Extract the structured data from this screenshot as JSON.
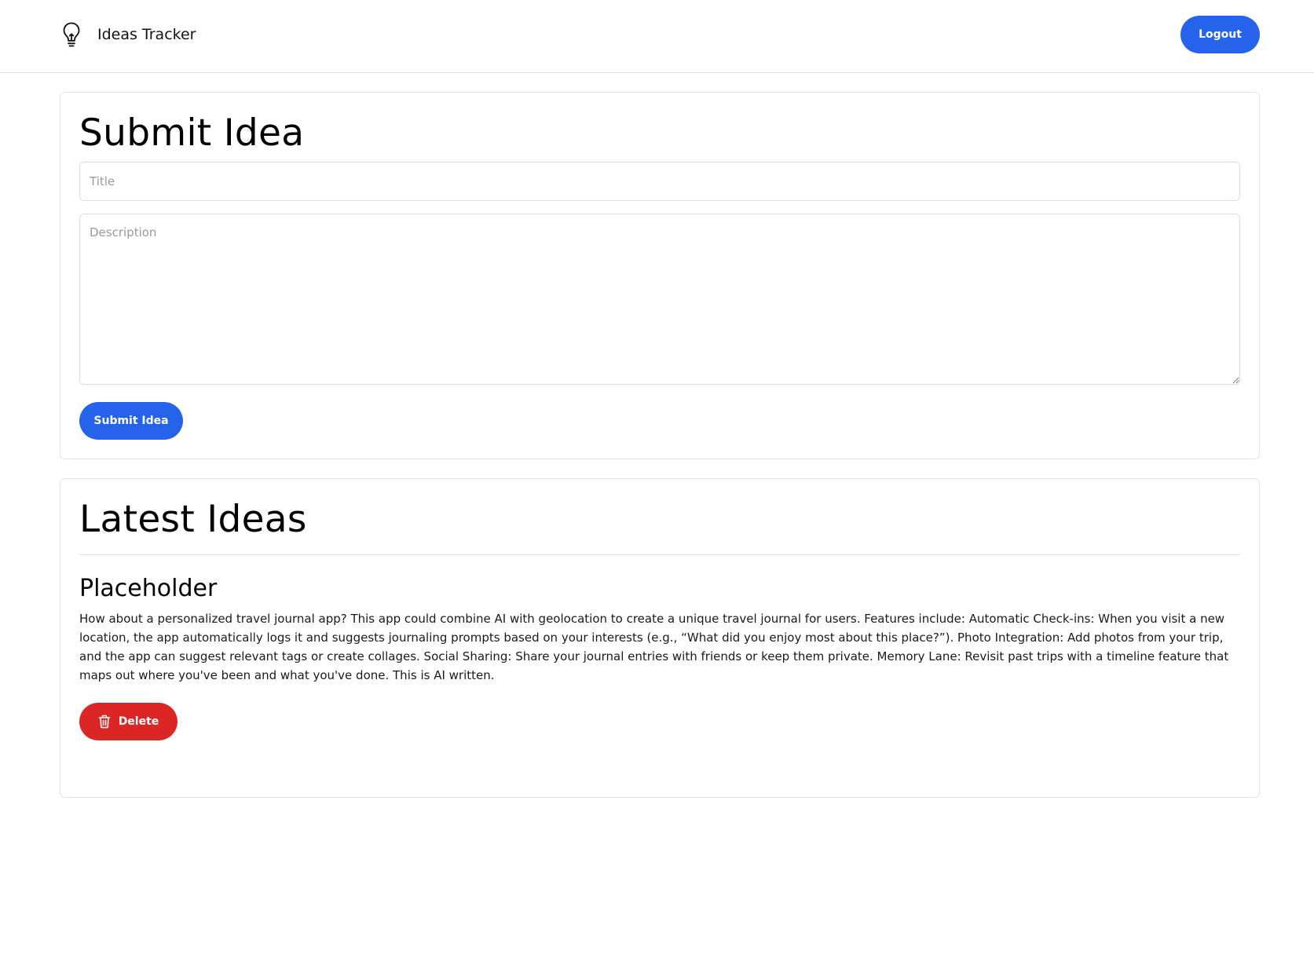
{
  "header": {
    "app_name": "Ideas Tracker",
    "logo_icon": "lightbulb-icon",
    "logout_label": "Logout"
  },
  "submit": {
    "heading": "Submit Idea",
    "title_placeholder": "Title",
    "title_value": "",
    "description_placeholder": "Description",
    "description_value": "",
    "button_label": "Submit Idea"
  },
  "latest": {
    "heading": "Latest Ideas",
    "ideas": [
      {
        "title": "Placeholder",
        "description": "How about a personalized travel journal app? This app could combine AI with geolocation to create a unique travel journal for users. Features include: Automatic Check-ins: When you visit a new location, the app automatically logs it and suggests journaling prompts based on your interests (e.g., “What did you enjoy most about this place?”). Photo Integration: Add photos from your trip, and the app can suggest relevant tags or create collages. Social Sharing: Share your journal entries with friends or keep them private. Memory Lane: Revisit past trips with a timeline feature that maps out where you've been and what you've done. This is AI written.",
        "delete_label": "Delete",
        "delete_icon": "trash-icon"
      }
    ]
  },
  "colors": {
    "primary": "#2563eb",
    "danger": "#dc2626",
    "border": "#e3e3e3",
    "placeholder": "#9a9a9a"
  }
}
